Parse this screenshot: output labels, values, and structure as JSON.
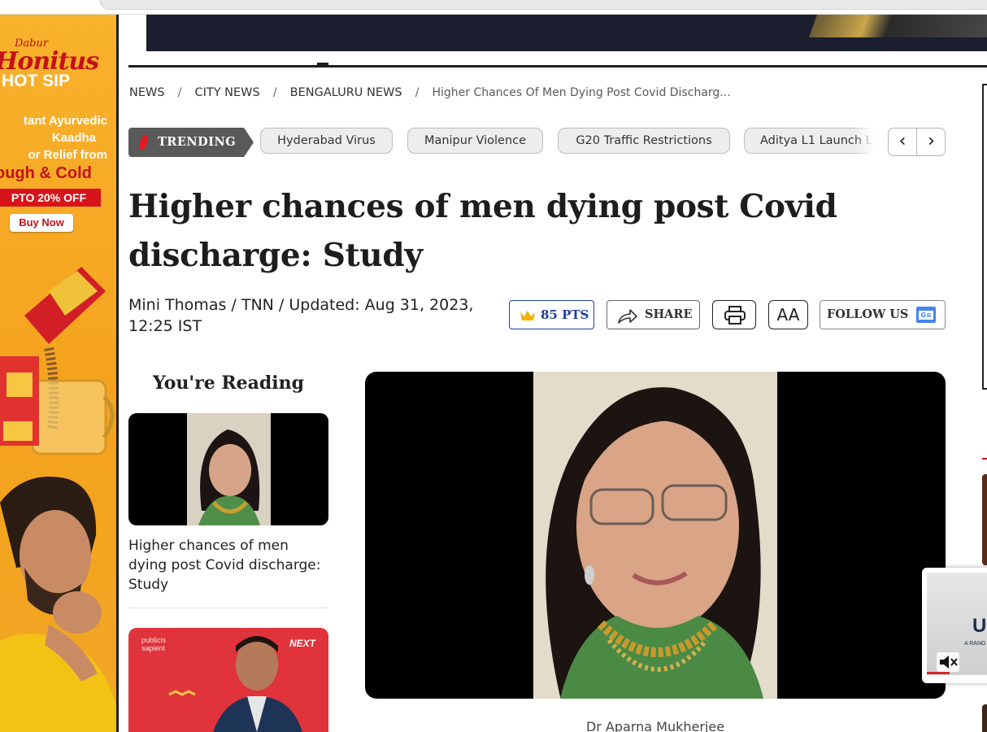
{
  "left_ad": {
    "brand_small": "Dabur",
    "brand": "Honitus",
    "product": "HOT SIP",
    "tagline_lines": [
      "tant Ayurvedic",
      "Kaadha",
      "or Relief from"
    ],
    "highlight": "ough & Cold",
    "offer": "PTO 20% OFF",
    "cta": "Buy Now"
  },
  "breadcrumb": {
    "items": [
      "NEWS",
      "CITY NEWS",
      "BENGALURU NEWS"
    ],
    "separator": "/",
    "current": "Higher Chances Of Men Dying Post Covid Discharg..."
  },
  "trending": {
    "label": "TRENDING",
    "chips": [
      "Hyderabad Virus",
      "Manipur Violence",
      "G20 Traffic Restrictions",
      "Aditya L1 Launch Li"
    ],
    "prev_label": "‹",
    "next_label": "›"
  },
  "article": {
    "headline": "Higher chances of men dying post Covid discharge: Study",
    "byline": "Mini Thomas / TNN / Updated: Aug 31, 2023, 12:25 IST",
    "caption": "Dr Aparna Mukherjee"
  },
  "actions": {
    "points": "85 PTS",
    "share": "SHARE",
    "font_size": "AA",
    "follow": "FOLLOW US",
    "follow_badge": "G≡"
  },
  "sidebar": {
    "reading_title": "You're Reading",
    "reading_item": "Higher chances of men dying post Covid discharge: Study",
    "promo_brand": "publicis sapient",
    "promo_badge": "NEXT"
  },
  "video": {
    "big_text": "U",
    "small_text": "A RANG"
  },
  "colors": {
    "accent_red": "#d8141b",
    "points_blue": "#1f3f9e",
    "ad_orange": "#f5a21e"
  }
}
